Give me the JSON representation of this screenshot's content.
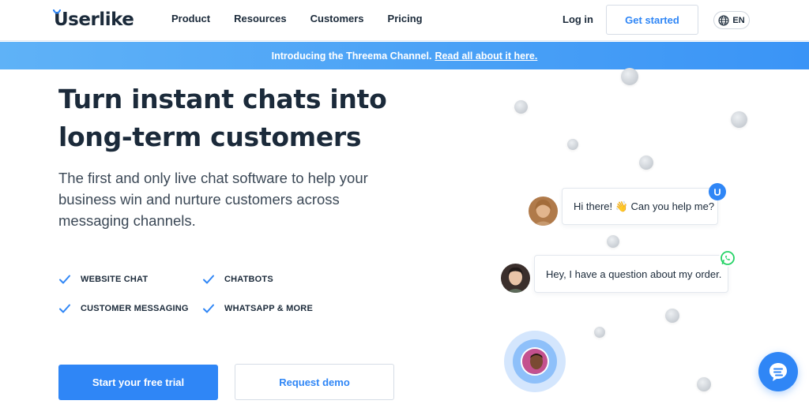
{
  "brand": {
    "name": "Userlike",
    "accent": "#2f86f6"
  },
  "nav": {
    "items": [
      "Product",
      "Resources",
      "Customers",
      "Pricing"
    ]
  },
  "header": {
    "login": "Log in",
    "cta": "Get started",
    "lang": "EN"
  },
  "banner": {
    "text": "Introducing the Threema Channel.",
    "link": "Read all about it here."
  },
  "hero": {
    "title": "Turn instant chats into long-term customers",
    "subtitle": "The first and only live chat software to help your business win and nurture customers across messaging channels.",
    "features": [
      "WEBSITE CHAT",
      "CHATBOTS",
      "CUSTOMER MESSAGING",
      "WHATSAPP & MORE"
    ],
    "primary_cta": "Start your free trial",
    "secondary_cta": "Request demo"
  },
  "illustration": {
    "bubble1": "Hi there! 👋  Can you help me?",
    "bubble2": "Hey, I have a question about my order.",
    "badge1_icon": "userlike-icon",
    "badge2_icon": "whatsapp-icon"
  }
}
